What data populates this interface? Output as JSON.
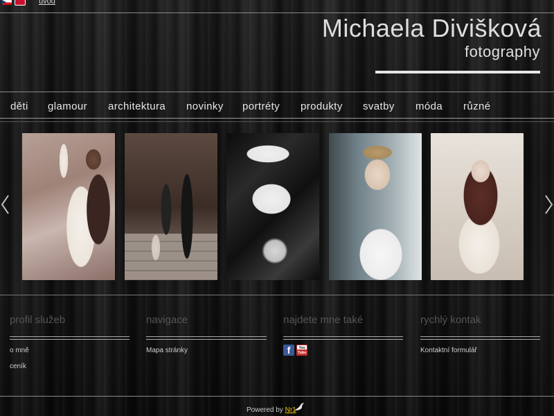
{
  "topbar": {
    "home_link": "úvod",
    "languages": [
      "czech-flag",
      "english-flag"
    ]
  },
  "brand": {
    "name": "Michaela Divišková",
    "subtitle": "fotography"
  },
  "nav": {
    "items": [
      {
        "label": "děti"
      },
      {
        "label": "glamour"
      },
      {
        "label": "architektura"
      },
      {
        "label": "novinky"
      },
      {
        "label": "portréty"
      },
      {
        "label": "produkty"
      },
      {
        "label": "svatby"
      },
      {
        "label": "móda"
      },
      {
        "label": "různé"
      }
    ]
  },
  "gallery": {
    "prev_icon": "chevron-left-icon",
    "next_icon": "chevron-right-icon",
    "photos": [
      "portrait-woman-lace-dress",
      "couple-on-steps",
      "woman-lying-black-and-white",
      "young-man-portrait",
      "woman-lace-dress-portrait"
    ]
  },
  "footer": {
    "columns": [
      {
        "title": "profil služeb",
        "links": [
          "o mně",
          "ceník"
        ]
      },
      {
        "title": "navigace",
        "links": [
          "Mapa stránky"
        ]
      },
      {
        "title": "najdete mne také",
        "icons": [
          "facebook-icon",
          "youtube-icon"
        ],
        "youtube_label_top": "You",
        "youtube_label_bottom": "Tube"
      },
      {
        "title": "rychlý kontak",
        "links": [
          "Kontaktní formulář"
        ]
      }
    ],
    "powered_prefix": "Powered by",
    "powered_link": "Nr1"
  },
  "colors": {
    "background": "#111111",
    "accent_link": "#f2c200",
    "facebook": "#3b5998",
    "youtube": "#c4302b"
  }
}
